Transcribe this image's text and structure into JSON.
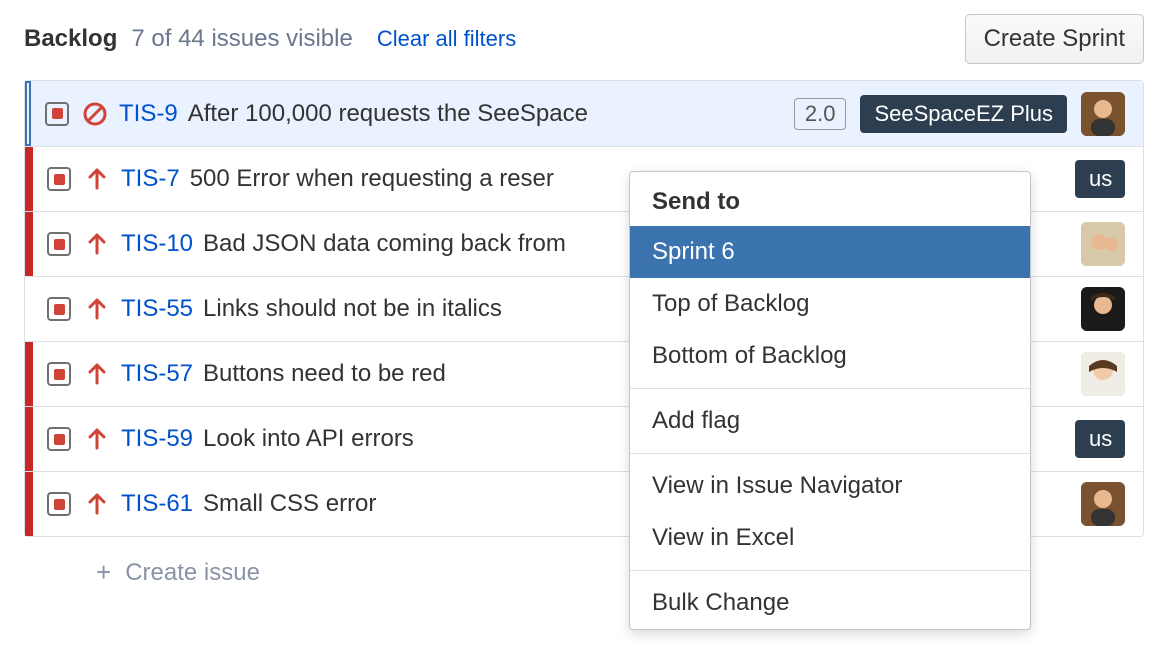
{
  "header": {
    "title": "Backlog",
    "countText": "7 of 44 issues visible",
    "clearFilters": "Clear all filters",
    "createSprint": "Create Sprint"
  },
  "issues": [
    {
      "key": "TIS-9",
      "summary": "After 100,000 requests the SeeSpace",
      "priority": "blocker",
      "version": "2.0",
      "epic": "SeeSpaceEZ Plus",
      "avatar": "m1"
    },
    {
      "key": "TIS-7",
      "summary": "500 Error when requesting a reser",
      "priority": "high",
      "epic_trunc": "us",
      "avatar": null
    },
    {
      "key": "TIS-10",
      "summary": "Bad JSON data coming back from",
      "priority": "high",
      "avatar": "m2"
    },
    {
      "key": "TIS-55",
      "summary": "Links should not be in italics",
      "priority": "high",
      "avatar": "f1"
    },
    {
      "key": "TIS-57",
      "summary": "Buttons need to be red",
      "priority": "high",
      "avatar": "f2"
    },
    {
      "key": "TIS-59",
      "summary": "Look into API errors",
      "priority": "high",
      "epic_trunc": "us",
      "avatar": null
    },
    {
      "key": "TIS-61",
      "summary": "Small CSS error",
      "priority": "high",
      "avatar": "m1"
    }
  ],
  "createIssue": "Create issue",
  "contextMenu": {
    "header": "Send to",
    "sendTo": [
      "Sprint 6",
      "Top of Backlog",
      "Bottom of Backlog"
    ],
    "activeIndex": 0,
    "group2": [
      "Add flag"
    ],
    "group3": [
      "View in Issue Navigator",
      "View in Excel"
    ],
    "group4": [
      "Bulk Change"
    ]
  }
}
